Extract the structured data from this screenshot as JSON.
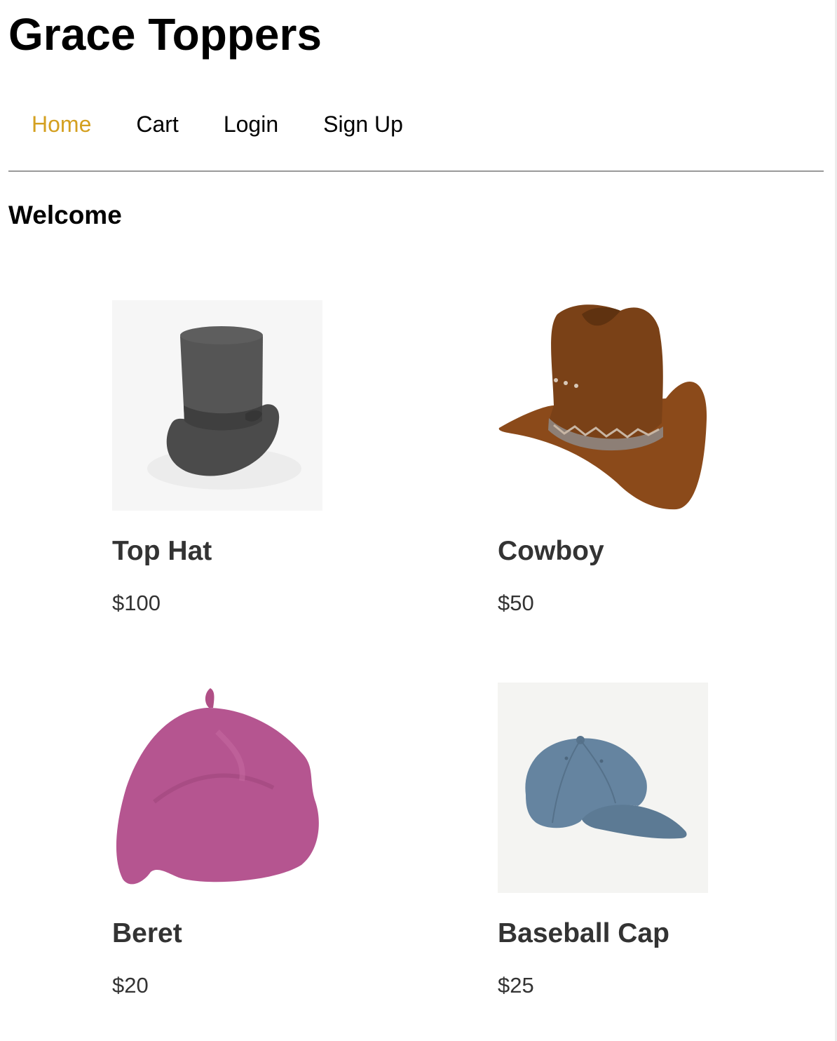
{
  "site": {
    "title": "Grace Toppers"
  },
  "nav": {
    "items": [
      {
        "label": "Home",
        "active": true
      },
      {
        "label": "Cart",
        "active": false
      },
      {
        "label": "Login",
        "active": false
      },
      {
        "label": "Sign Up",
        "active": false
      }
    ],
    "active_color": "#d4a020"
  },
  "main": {
    "heading": "Welcome",
    "products": [
      {
        "name": "Top Hat",
        "price": "$100",
        "image": "top-hat-image"
      },
      {
        "name": "Cowboy",
        "price": "$50",
        "image": "cowboy-hat-image"
      },
      {
        "name": "Beret",
        "price": "$20",
        "image": "beret-image"
      },
      {
        "name": "Baseball Cap",
        "price": "$25",
        "image": "baseball-cap-image"
      }
    ]
  },
  "colors": {
    "text_dark": "#333333",
    "top_hat": "#4a4a4a",
    "cowboy": "#8a4a1c",
    "beret": "#b5568e",
    "baseball_cap": "#5f7d96"
  }
}
